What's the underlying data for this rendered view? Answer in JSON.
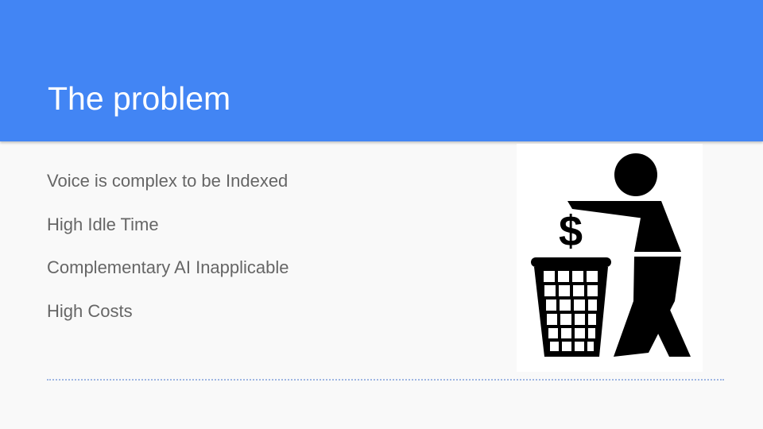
{
  "slide": {
    "title": "The problem",
    "bullets": [
      "Voice is complex to be Indexed",
      "High Idle Time",
      "Complementary AI Inapplicable",
      "High Costs"
    ],
    "illustration": {
      "icon": "tidy-man-trash-icon",
      "symbol": "$"
    }
  },
  "colors": {
    "header": "#4285f4",
    "background": "#f9f9f9",
    "title_text": "#ffffff",
    "body_text": "#666666",
    "divider": "#9fb6e3"
  }
}
